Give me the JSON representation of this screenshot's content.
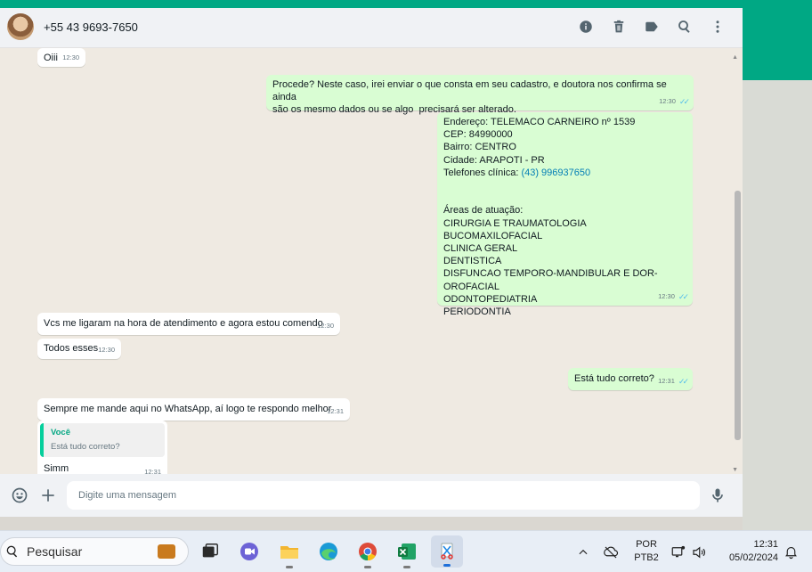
{
  "header": {
    "contact": "+55 43 9693-7650",
    "icons": [
      "info-icon",
      "trash-icon",
      "label-icon",
      "search-icon",
      "menu-icon"
    ]
  },
  "messages": [
    {
      "dir": "in",
      "text": "Oiii",
      "time": "12:30"
    },
    {
      "dir": "out",
      "text": "Procede? Neste caso, irei enviar o que consta em seu cadastro, e doutora nos confirma se ainda\nsão os mesmo dados ou se algo  precisará ser alterado.",
      "time": "12:30"
    },
    {
      "dir": "out",
      "lines_before_link": "Endereço: TELEMACO CARNEIRO nº 1539\nCEP: 84990000\nBairro: CENTRO\nCidade: ARAPOTI - PR\nTelefones clínica: ",
      "link": "(43) 996937650",
      "lines_after_link": "\n\n\nÁreas de atuação:\nCIRURGIA E TRAUMATOLOGIA BUCOMAXILOFACIAL\nCLINICA GERAL\nDENTISTICA\nDISFUNCAO TEMPORO-MANDIBULAR E DOR-OROFACIAL\nODONTOPEDIATRIA\nPERIODONTIA",
      "time": "12:30"
    },
    {
      "dir": "in",
      "text": "Vcs me ligaram na hora de atendimento e agora estou comendo",
      "time": "12:30"
    },
    {
      "dir": "in",
      "text": "Todos esses",
      "time": "12:30"
    },
    {
      "dir": "out",
      "text": "Está tudo correto?",
      "time": "12:31"
    },
    {
      "dir": "in",
      "text": "Sempre me mande aqui no WhatsApp, aí logo te respondo melhor",
      "time": "12:31"
    },
    {
      "dir": "in",
      "quote_author": "Você",
      "quote_text": "Está tudo correto?",
      "text": "Simm",
      "time": "12:31"
    }
  ],
  "composer": {
    "placeholder": "Digite uma mensagem"
  },
  "taskbar": {
    "search_label": "Pesquisar",
    "lang_line1": "POR",
    "lang_line2": "PTB2",
    "time": "12:31",
    "date": "05/02/2024"
  },
  "colors": {
    "accent": "#00a884",
    "outgoing_bubble": "#d9fdd3",
    "incoming_bubble": "#ffffff",
    "chat_bg": "#efeae2",
    "read_ticks": "#53bdeb",
    "link": "#027eb5"
  }
}
